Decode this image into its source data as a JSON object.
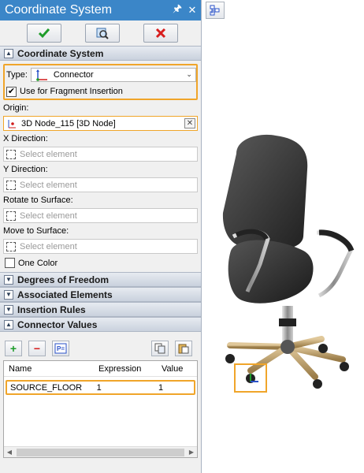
{
  "panel": {
    "title": "Coordinate System",
    "title_buttons": {
      "pin": "↑",
      "close": "✕"
    },
    "toolbar": {
      "ok_icon": "checkmark-icon",
      "preview_icon": "preview-icon",
      "cancel_icon": "cancel-x-icon"
    }
  },
  "sections": {
    "coordinate_system": "Coordinate System",
    "degrees_of_freedom": "Degrees of Freedom",
    "associated_elements": "Associated Elements",
    "insertion_rules": "Insertion Rules",
    "connector_values": "Connector Values"
  },
  "coordinate_system": {
    "type_label": "Type:",
    "type_value": "Connector",
    "use_fragment_label": "Use for Fragment Insertion",
    "use_fragment_checked": true,
    "origin_label": "Origin:",
    "origin_value": "3D Node_115 [3D Node]",
    "x_direction_label": "X Direction:",
    "x_direction_placeholder": "Select element",
    "y_direction_label": "Y Direction:",
    "y_direction_placeholder": "Select element",
    "rotate_label": "Rotate to Surface:",
    "rotate_placeholder": "Select element",
    "move_label": "Move to Surface:",
    "move_placeholder": "Select element",
    "one_color_label": "One Color",
    "one_color_checked": false
  },
  "connector_values": {
    "columns": [
      "Name",
      "Expression",
      "Value"
    ],
    "rows": [
      {
        "name": "SOURCE_FLOOR",
        "expression": "1",
        "value": "1"
      }
    ]
  },
  "colors": {
    "title_bar": "#3b86c8",
    "highlight": "#f0a52a",
    "ok_green": "#1e9c2a",
    "cancel_red": "#d81e1e"
  }
}
